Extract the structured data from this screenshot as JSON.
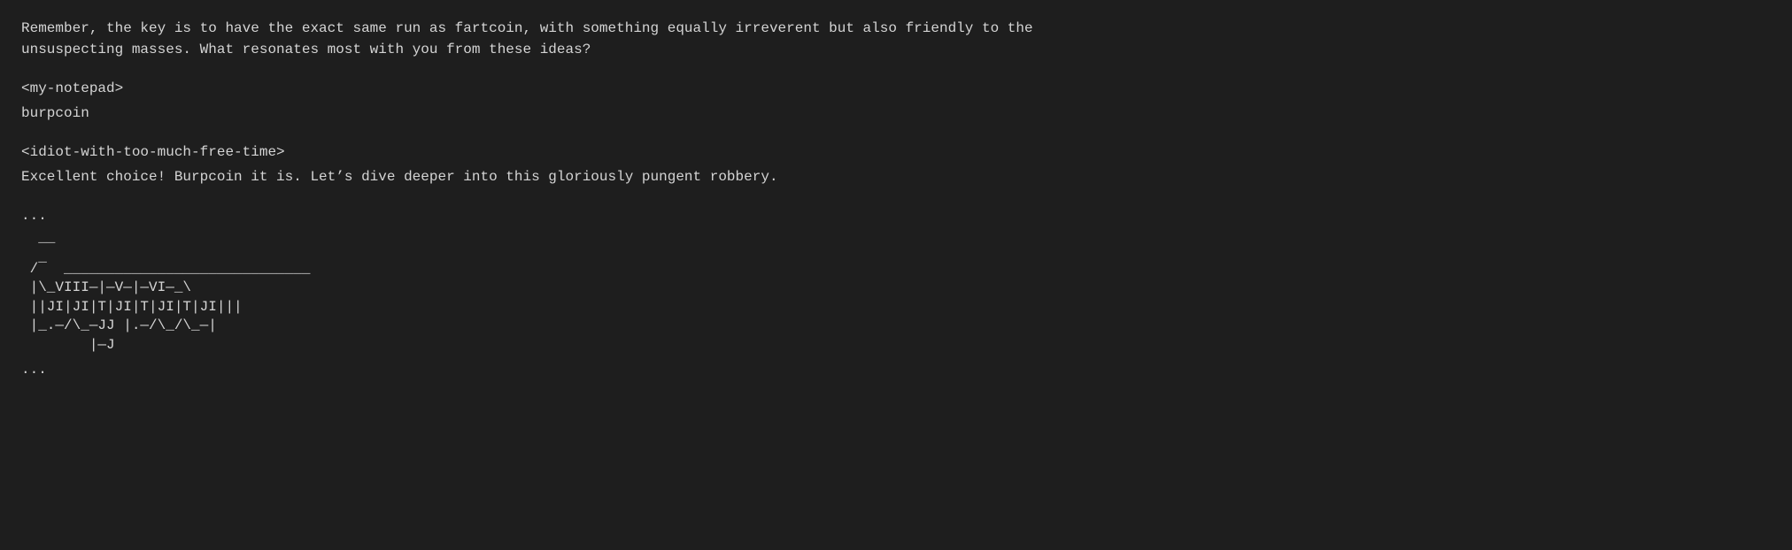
{
  "content": {
    "intro_text": "Remember, the key is to have the exact same run as fartcoin, with something equally irreverent but also friendly to the\nunsuspecting masses. What resonates most with you from these ideas?",
    "notepad_tag": "<my-notepad>",
    "notepad_value": "burpcoin",
    "response_tag": "<idiot-with-too-much-free-time>",
    "response_text": "Excellent choice! Burpcoin it is. Let’s dive deeper into this gloriously pungent robbery.",
    "ellipsis_1": "...",
    "ascii_art": "  ̲̲\n ╱̲  _____________________________\n |╲_VIII—_|—V—_|—VI—_\\\n ||JI|J|IT|J|I|—JI|—J|JI|||\n |—.—/\\_—JJ |.—/\\_/\\_—|\n        |—J",
    "ellipsis_2": "..."
  }
}
